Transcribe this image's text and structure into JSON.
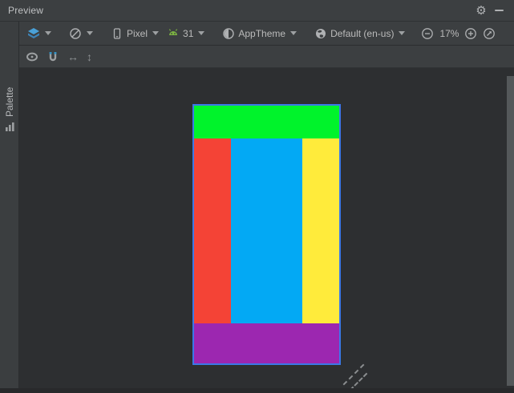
{
  "window": {
    "title": "Preview"
  },
  "glyphs": {
    "gear": "⚙",
    "h_arrow": "↔",
    "v_arrow": "↕"
  },
  "toolbar": {
    "device": "Pixel",
    "api_level": "31",
    "theme": "AppTheme",
    "locale": "Default (en-us)",
    "zoom_percent": "17%"
  },
  "sidebar": {
    "palette_tab": "Palette"
  },
  "preview": {
    "selection_border_color": "#3B78E7",
    "regions": [
      {
        "name": "top-banner",
        "color": "#00F32B"
      },
      {
        "name": "left-column",
        "color": "#F44336"
      },
      {
        "name": "center-column",
        "color": "#03A9F4"
      },
      {
        "name": "right-column",
        "color": "#FFEB3B"
      },
      {
        "name": "bottom-banner",
        "color": "#9C27B0"
      }
    ]
  },
  "colors": {
    "titlebar_bg": "#3C3F41",
    "design_bg": "#2D2F31",
    "stripe_bg": "#3B3E40",
    "accent_blue": "#3592C4",
    "android_green": "#7CB342"
  }
}
